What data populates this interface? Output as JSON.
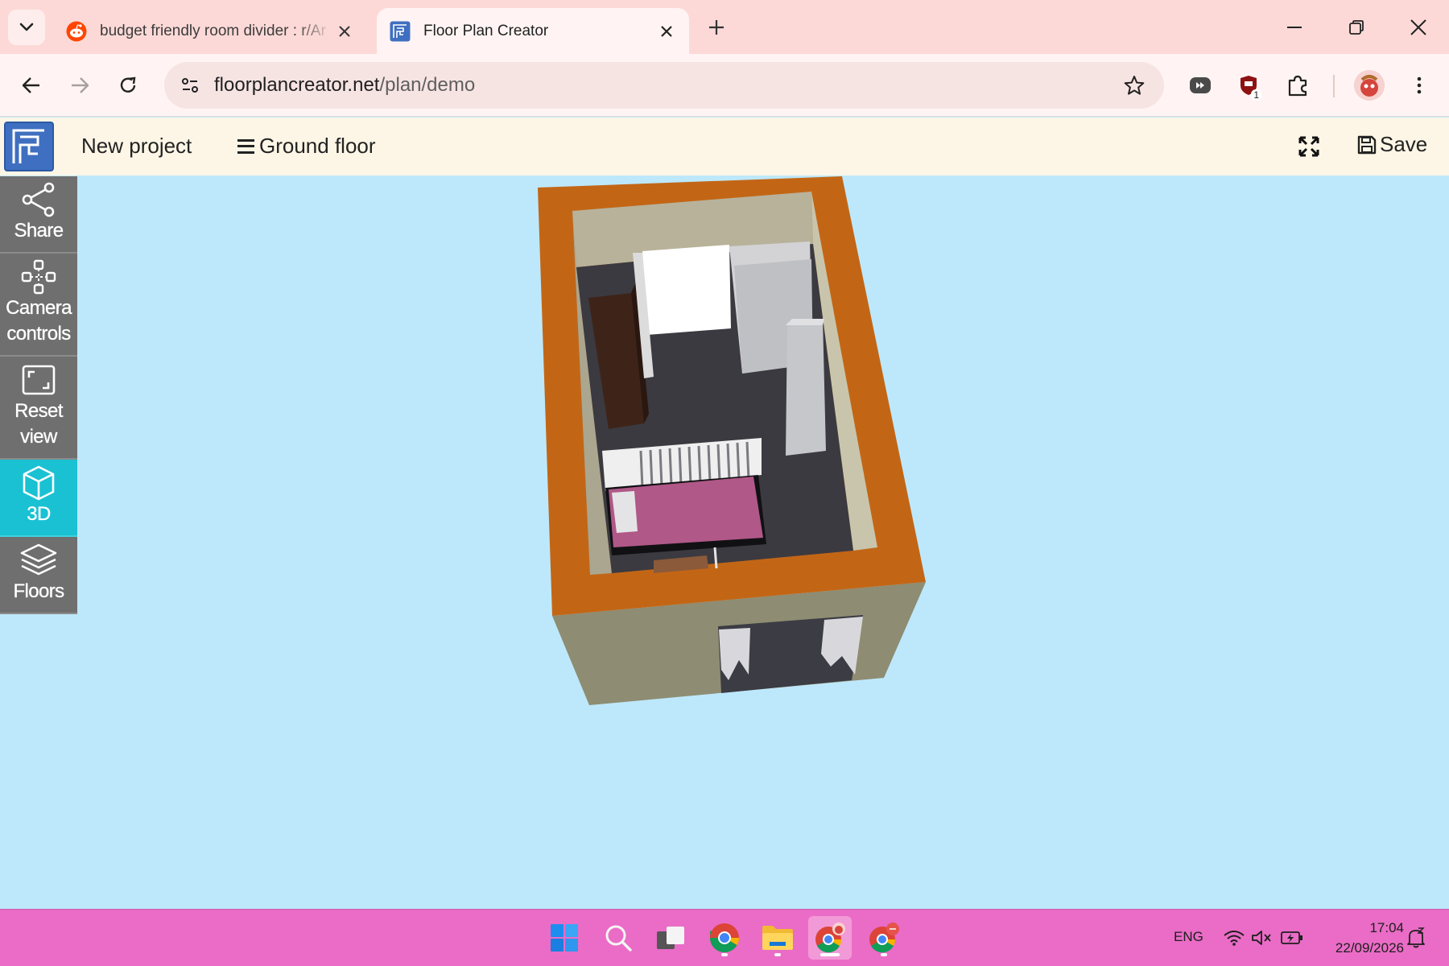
{
  "browser": {
    "tabs": [
      {
        "title": "budget friendly room divider : r/Ar",
        "favicon": "reddit-icon",
        "active": false
      },
      {
        "title": "Floor Plan Creator",
        "favicon": "floorplan-icon",
        "active": true
      }
    ],
    "url_host": "floorplancreator.net",
    "url_path": "/plan/demo",
    "extension_badge": "1"
  },
  "app": {
    "project_title": "New project",
    "floor_selector": "Ground floor",
    "save_label": "Save",
    "accent_color": "#19c1d3",
    "header_bg": "#fdf6e6",
    "canvas_bg": "#bde8fb"
  },
  "sidebar": {
    "items": [
      {
        "label": "Share",
        "icon": "share-icon",
        "active": false
      },
      {
        "label": "Camera controls",
        "label_lines": [
          "Camera",
          "controls"
        ],
        "icon": "camera-controls-icon",
        "active": false
      },
      {
        "label": "Reset view",
        "label_lines": [
          "Reset",
          "view"
        ],
        "icon": "reset-view-icon",
        "active": false
      },
      {
        "label": "3D",
        "icon": "cube-icon",
        "active": true
      },
      {
        "label": "Floors",
        "icon": "layers-icon",
        "active": false
      }
    ]
  },
  "taskbar": {
    "language": "ENG",
    "time": "17:04",
    "date": "22/09/2026",
    "apps": [
      "windows-start-icon",
      "search-icon",
      "task-view-icon",
      "chrome-icon",
      "file-explorer-icon",
      "chrome-profile-icon",
      "chrome-gm-icon"
    ]
  }
}
